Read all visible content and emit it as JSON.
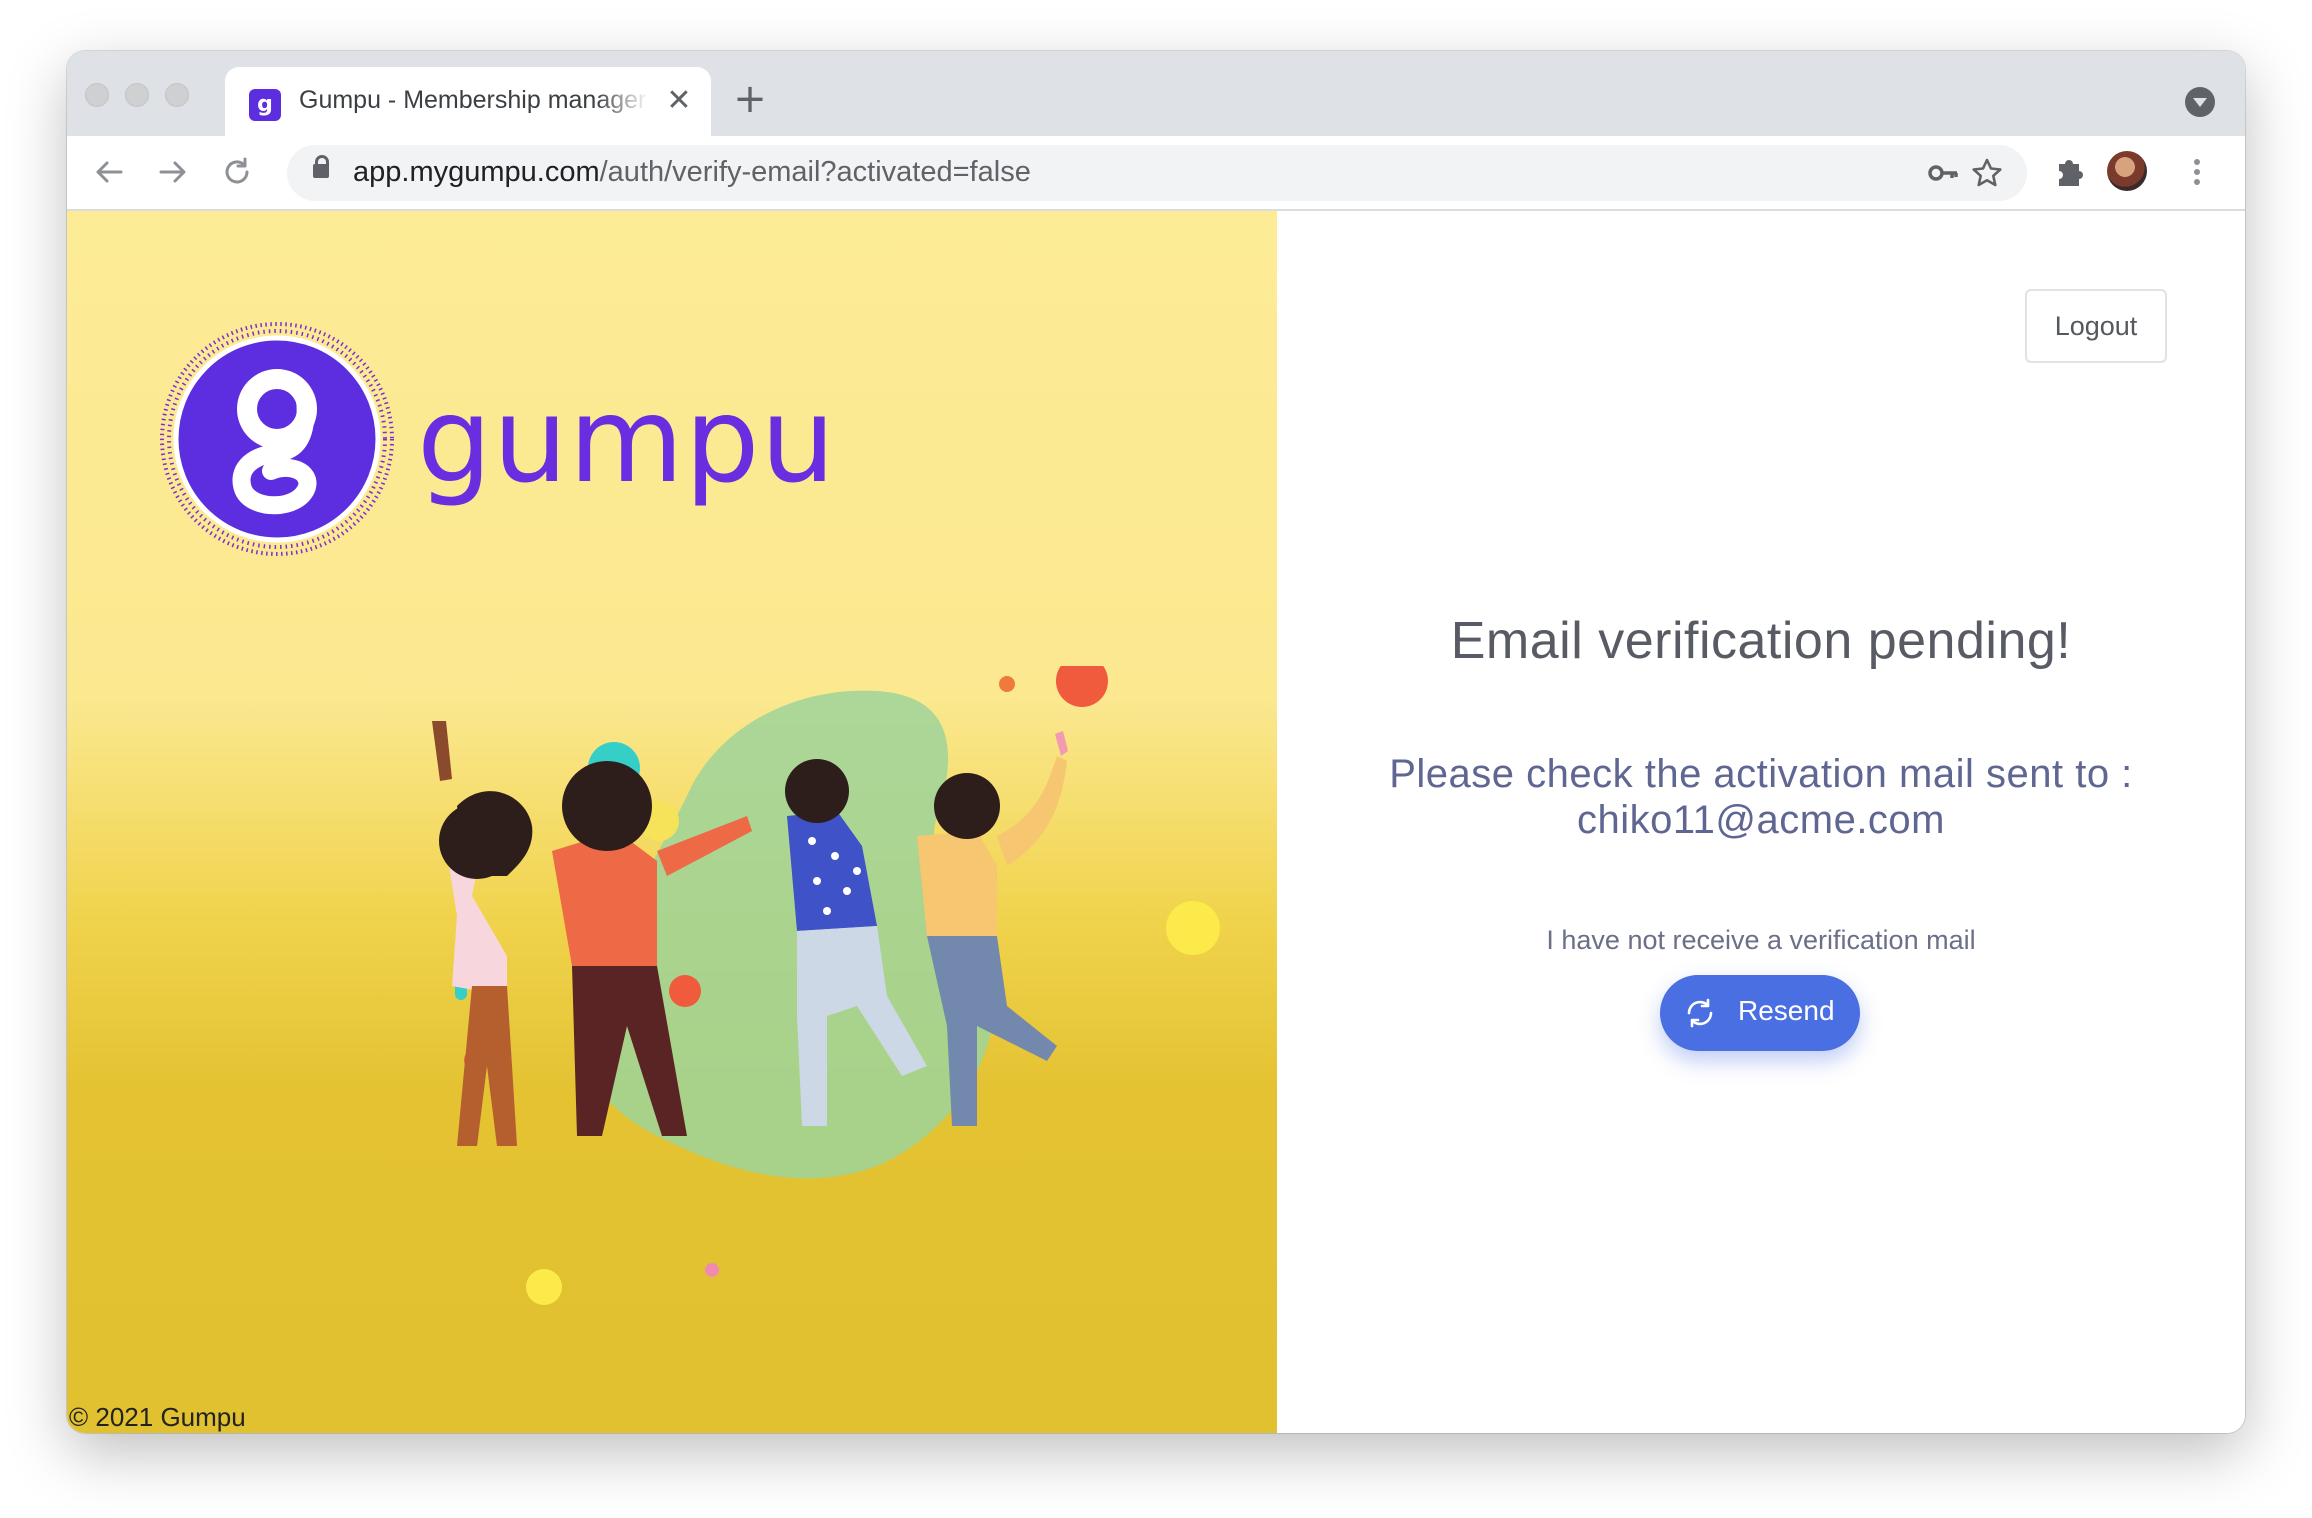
{
  "browser": {
    "tab": {
      "title": "Gumpu - Membership manager",
      "favicon_letter": "g"
    },
    "new_tab_symbol": "+",
    "close_symbol": "✕",
    "address": {
      "host": "app.mygumpu.com",
      "path": "/auth/verify-email?activated=false"
    }
  },
  "brand": {
    "name": "gumpu",
    "logo_letter": "g",
    "color": "#6a2de0"
  },
  "footer": {
    "copyright": "© 2021 Gumpu"
  },
  "header": {
    "logout_label": "Logout"
  },
  "verification": {
    "heading": "Email verification pending!",
    "message_line1": "Please check the activation mail sent to :",
    "email": "chiko11@acme.com",
    "not_received": "I have not receive a verification mail",
    "resend_label": "Resend"
  },
  "colors": {
    "accent": "#4a6fe3",
    "panel_yellow": "#fbe88f",
    "brand_purple": "#5d2ee0"
  },
  "icons": {
    "back": "arrow-left-icon",
    "forward": "arrow-right-icon",
    "reload": "reload-icon",
    "lock": "lock-icon",
    "key": "key-icon",
    "star": "star-icon",
    "extensions": "puzzle-icon",
    "menu": "kebab-menu-icon",
    "resend": "refresh-icon"
  }
}
